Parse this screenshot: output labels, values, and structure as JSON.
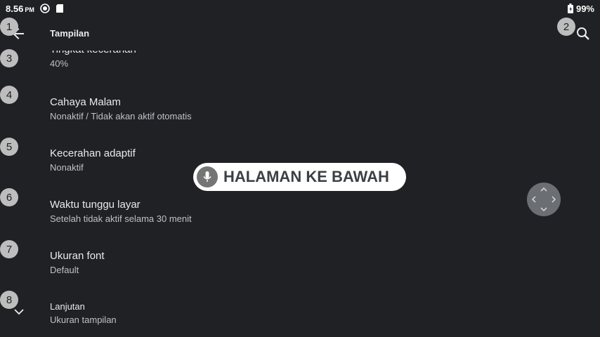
{
  "status_bar": {
    "time": "8.56",
    "ampm": "PM",
    "battery": "99%"
  },
  "toolbar": {
    "title": "Tampilan"
  },
  "items": [
    {
      "title": "Tingkat kecerahan",
      "subtitle": "40%"
    },
    {
      "title": "Cahaya Malam",
      "subtitle": "Nonaktif / Tidak akan aktif otomatis"
    },
    {
      "title": "Kecerahan adaptif",
      "subtitle": "Nonaktif"
    },
    {
      "title": "Waktu tunggu layar",
      "subtitle": "Setelah tidak aktif selama 30 menit"
    },
    {
      "title": "Ukuran font",
      "subtitle": "Default"
    },
    {
      "title": "Lanjutan",
      "subtitle": "Ukuran tampilan"
    }
  ],
  "badges": [
    "1",
    "2",
    "3",
    "4",
    "5",
    "6",
    "7",
    "8"
  ],
  "voice_overlay": {
    "label": "HALAMAN KE BAWAH"
  },
  "colors": {
    "background": "#202124",
    "badge": "#bdbdbd",
    "pill": "#ffffff"
  }
}
